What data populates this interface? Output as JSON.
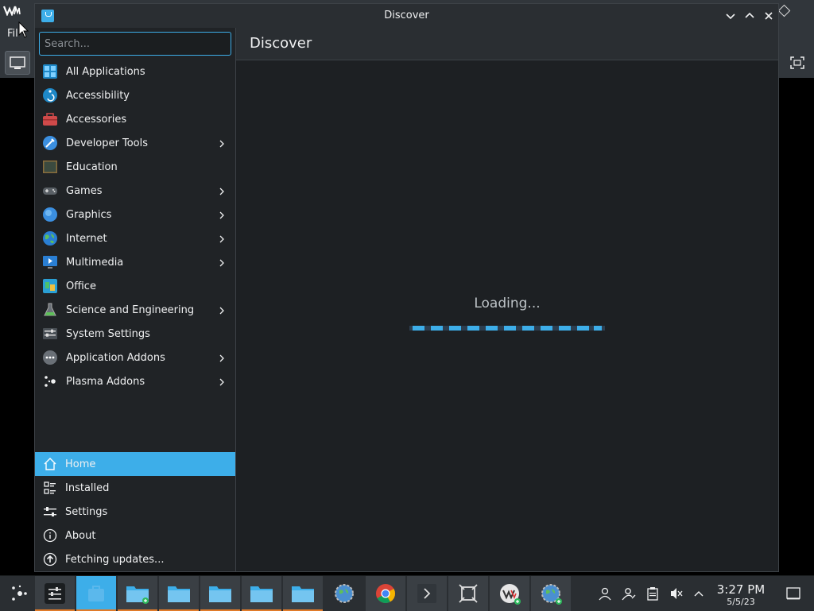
{
  "background_app": {
    "menu_label": "Fil"
  },
  "window": {
    "title": "Discover"
  },
  "search": {
    "placeholder": "Search..."
  },
  "categories": [
    {
      "label": "All Applications",
      "icon": "grid-icon",
      "has_sub": false
    },
    {
      "label": "Accessibility",
      "icon": "accessibility-icon",
      "has_sub": false
    },
    {
      "label": "Accessories",
      "icon": "toolbox-icon",
      "has_sub": false
    },
    {
      "label": "Developer Tools",
      "icon": "developer-tools-icon",
      "has_sub": true
    },
    {
      "label": "Education",
      "icon": "blackboard-icon",
      "has_sub": false
    },
    {
      "label": "Games",
      "icon": "gamepad-icon",
      "has_sub": true
    },
    {
      "label": "Graphics",
      "icon": "graphics-icon",
      "has_sub": true
    },
    {
      "label": "Internet",
      "icon": "globe-icon",
      "has_sub": true
    },
    {
      "label": "Multimedia",
      "icon": "multimedia-icon",
      "has_sub": true
    },
    {
      "label": "Office",
      "icon": "office-icon",
      "has_sub": false
    },
    {
      "label": "Science and Engineering",
      "icon": "flask-icon",
      "has_sub": true
    },
    {
      "label": "System Settings",
      "icon": "system-settings-icon",
      "has_sub": false
    },
    {
      "label": "Application Addons",
      "icon": "addons-icon",
      "has_sub": true
    },
    {
      "label": "Plasma Addons",
      "icon": "plasma-addons-icon",
      "has_sub": true
    }
  ],
  "nav": {
    "home": "Home",
    "installed": "Installed",
    "settings": "Settings",
    "about": "About",
    "fetching": "Fetching updates..."
  },
  "main": {
    "title": "Discover",
    "loading": "Loading..."
  },
  "taskbar": {
    "clock_time": "3:27 PM",
    "clock_date": "5/5/23"
  },
  "colors": {
    "accent": "#3daee9",
    "window_bg": "#202326",
    "header_bg": "#2a2e32"
  }
}
